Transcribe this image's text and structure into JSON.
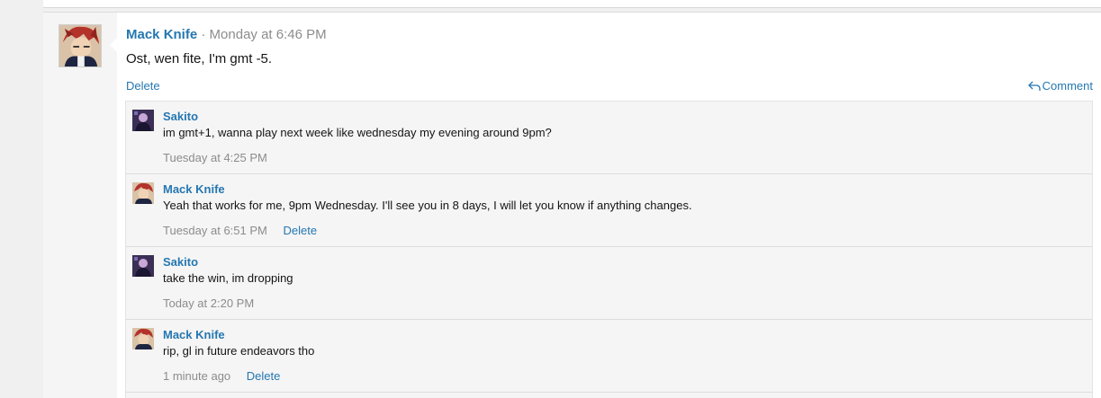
{
  "post": {
    "author": "Mack Knife",
    "separator": "·",
    "time": "Monday at 6:46 PM",
    "text": "Ost, wen fite, I'm gmt -5.",
    "delete_label": "Delete",
    "comment_label": "Comment",
    "comment_icon": "reply-arrow-icon"
  },
  "comments": [
    {
      "author": "Sakito",
      "text": "im gmt+1, wanna play next week like wednesday my evening around 9pm?",
      "time": "Tuesday at 4:25 PM",
      "delete_label": ""
    },
    {
      "author": "Mack Knife",
      "text": "Yeah that works for me, 9pm Wednesday. I'll see you in 8 days, I will let you know if anything changes.",
      "time": "Tuesday at 6:51 PM",
      "delete_label": "Delete"
    },
    {
      "author": "Sakito",
      "text": "take the win, im dropping",
      "time": "Today at 2:20 PM",
      "delete_label": ""
    },
    {
      "author": "Mack Knife",
      "text": "rip, gl in future endeavors tho",
      "time": "1 minute ago",
      "delete_label": "Delete"
    }
  ],
  "colors": {
    "link": "#2577b1",
    "muted": "#8c8c8c",
    "text": "#141414",
    "comment_bg": "#f5f5f5"
  }
}
